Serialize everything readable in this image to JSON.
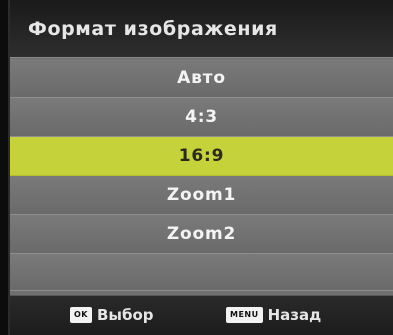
{
  "title": "Формат изображения",
  "menu": {
    "items": [
      {
        "label": "Авто",
        "selected": false
      },
      {
        "label": "4:3",
        "selected": false
      },
      {
        "label": "16:9",
        "selected": true
      },
      {
        "label": "Zoom1",
        "selected": false
      },
      {
        "label": "Zoom2",
        "selected": false
      }
    ]
  },
  "footer": {
    "ok_key": "OK",
    "ok_label": "Выбор",
    "menu_key": "MENU",
    "menu_label": "Назад"
  },
  "colors": {
    "highlight": "#c6d23a",
    "panel": "#6f6f6f",
    "header": "#262626"
  }
}
